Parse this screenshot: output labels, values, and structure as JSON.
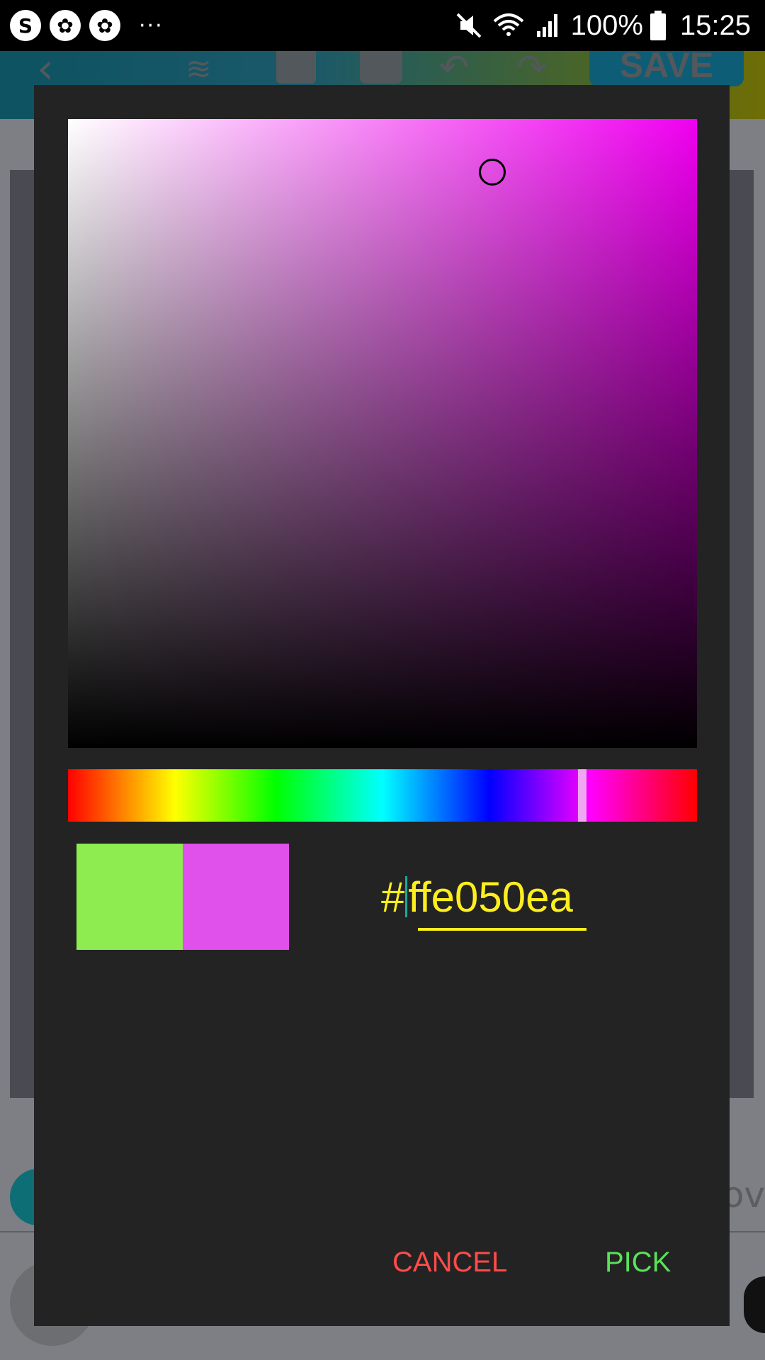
{
  "status_bar": {
    "left_icons": [
      "skype-icon",
      "flower-icon",
      "flower-icon"
    ],
    "more_dots": "···",
    "battery_percent": "100%",
    "time": "15:25",
    "icons": [
      "mute-icon",
      "wifi-icon",
      "signal-icon",
      "battery-icon"
    ]
  },
  "app_toolbar": {
    "save_label": "SAVE",
    "icons": [
      "back-icon",
      "layers-icon",
      "crop-icon",
      "lock-icon",
      "undo-icon",
      "redo-icon"
    ]
  },
  "app_background": {
    "input_hint_partial": "dov"
  },
  "color_picker": {
    "sv_colors": {
      "hue": "#f000f0",
      "selected": "#e050ea"
    },
    "hue_selected_fraction": 0.82,
    "old_color": "#8eeb50",
    "new_color": "#e050ea",
    "hex_prefix": "#",
    "hex_value": "ffe050ea",
    "cancel_label": "CANCEL",
    "pick_label": "PICK",
    "accent_colors": {
      "cancel": "#ff4b4b",
      "pick": "#5be05a",
      "hex_text": "#ffee1e"
    }
  }
}
